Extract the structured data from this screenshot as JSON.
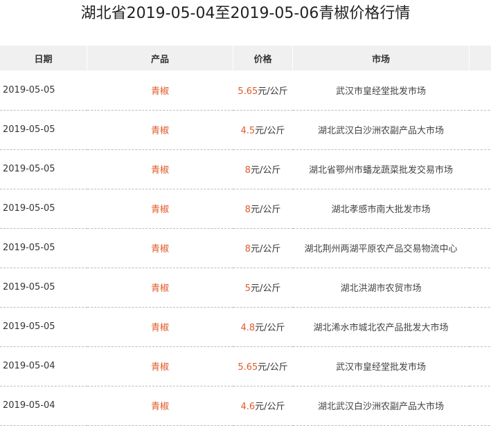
{
  "title": "湖北省2019-05-04至2019-05-06青椒价格行情",
  "headers": {
    "date": "日期",
    "product": "产品",
    "price": "价格",
    "market": "市场"
  },
  "rows": [
    {
      "date": "2019-05-05",
      "product": "青椒",
      "price": "5.65",
      "unit": "元/公斤",
      "market": "武汉市皇经堂批发市场"
    },
    {
      "date": "2019-05-05",
      "product": "青椒",
      "price": "4.5",
      "unit": "元/公斤",
      "market": "湖北武汉白沙洲农副产品大市场"
    },
    {
      "date": "2019-05-05",
      "product": "青椒",
      "price": "8",
      "unit": "元/公斤",
      "market": "湖北省鄂州市蟠龙蔬菜批发交易市场"
    },
    {
      "date": "2019-05-05",
      "product": "青椒",
      "price": "8",
      "unit": "元/公斤",
      "market": "湖北孝感市南大批发市场"
    },
    {
      "date": "2019-05-05",
      "product": "青椒",
      "price": "8",
      "unit": "元/公斤",
      "market": "湖北荆州两湖平原农产品交易物流中心"
    },
    {
      "date": "2019-05-05",
      "product": "青椒",
      "price": "5",
      "unit": "元/公斤",
      "market": "湖北洪湖市农贸市场"
    },
    {
      "date": "2019-05-05",
      "product": "青椒",
      "price": "4.8",
      "unit": "元/公斤",
      "market": "湖北浠水市城北农产品批发大市场"
    },
    {
      "date": "2019-05-04",
      "product": "青椒",
      "price": "5.65",
      "unit": "元/公斤",
      "market": "武汉市皇经堂批发市场"
    },
    {
      "date": "2019-05-04",
      "product": "青椒",
      "price": "4.6",
      "unit": "元/公斤",
      "market": "湖北武汉白沙洲农副产品大市场"
    }
  ]
}
